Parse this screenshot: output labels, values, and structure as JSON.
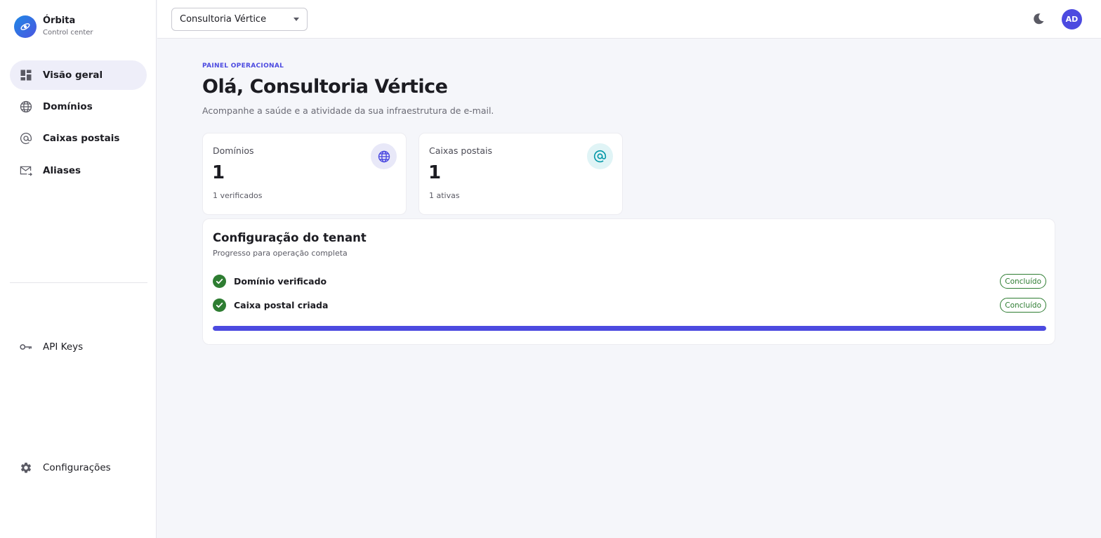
{
  "brand": {
    "name": "Órbita",
    "subtitle": "Control center"
  },
  "sidebar": {
    "items": [
      {
        "label": "Visão geral",
        "icon": "dashboard-icon",
        "active": true
      },
      {
        "label": "Domínios",
        "icon": "globe-icon",
        "active": false
      },
      {
        "label": "Caixas postais",
        "icon": "at-sign-icon",
        "active": false
      },
      {
        "label": "Aliases",
        "icon": "mail-forward-icon",
        "active": false
      }
    ],
    "secondary": [
      {
        "label": "API Keys",
        "icon": "key-icon"
      },
      {
        "label": "Configurações",
        "icon": "gear-icon"
      }
    ]
  },
  "topbar": {
    "tenant_selected": "Consultoria Vértice",
    "theme_icon": "moon-icon",
    "avatar_initials": "AD"
  },
  "main": {
    "eyebrow": "PAINEL OPERACIONAL",
    "title": "Olá, Consultoria Vértice",
    "subtitle": "Acompanhe a saúde e a atividade da sua infraestrutura de e-mail.",
    "stats": [
      {
        "label": "Domínios",
        "value": "1",
        "hint": "1 verificados",
        "icon": "globe-icon",
        "accent": "#4c4ae0",
        "bubble": "#e8e8f8"
      },
      {
        "label": "Caixas postais",
        "value": "1",
        "hint": "1 ativas",
        "icon": "at-sign-icon",
        "accent": "#0097a7",
        "bubble": "#e0f4f6"
      }
    ],
    "setup": {
      "title": "Configuração do tenant",
      "subtitle": "Progresso para operação completa",
      "steps": [
        {
          "label": "Domínio verificado",
          "status": "Concluído"
        },
        {
          "label": "Caixa postal criada",
          "status": "Concluído"
        }
      ],
      "progress_percent": 100
    }
  },
  "colors": {
    "primary": "#4c4ae0",
    "success": "#2e7d32",
    "background": "#f5f6fa"
  }
}
